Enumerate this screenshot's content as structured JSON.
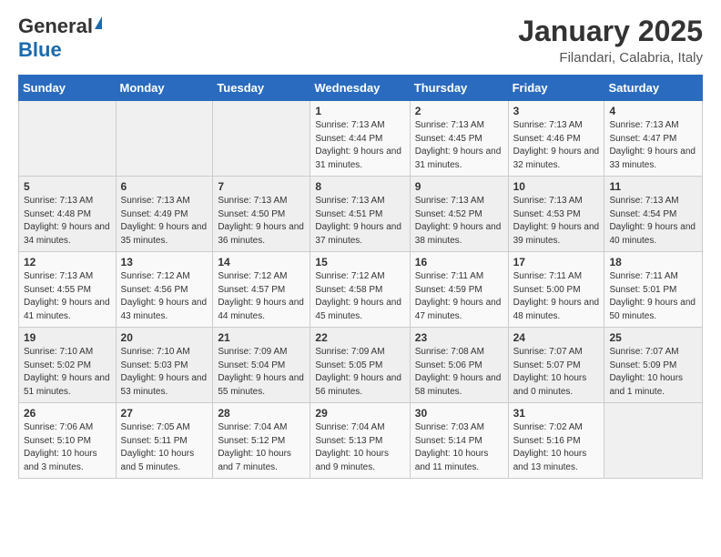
{
  "logo": {
    "general": "General",
    "blue": "Blue"
  },
  "header": {
    "month": "January 2025",
    "location": "Filandari, Calabria, Italy"
  },
  "weekdays": [
    "Sunday",
    "Monday",
    "Tuesday",
    "Wednesday",
    "Thursday",
    "Friday",
    "Saturday"
  ],
  "weeks": [
    [
      {
        "day": "",
        "info": ""
      },
      {
        "day": "",
        "info": ""
      },
      {
        "day": "",
        "info": ""
      },
      {
        "day": "1",
        "info": "Sunrise: 7:13 AM\nSunset: 4:44 PM\nDaylight: 9 hours and 31 minutes."
      },
      {
        "day": "2",
        "info": "Sunrise: 7:13 AM\nSunset: 4:45 PM\nDaylight: 9 hours and 31 minutes."
      },
      {
        "day": "3",
        "info": "Sunrise: 7:13 AM\nSunset: 4:46 PM\nDaylight: 9 hours and 32 minutes."
      },
      {
        "day": "4",
        "info": "Sunrise: 7:13 AM\nSunset: 4:47 PM\nDaylight: 9 hours and 33 minutes."
      }
    ],
    [
      {
        "day": "5",
        "info": "Sunrise: 7:13 AM\nSunset: 4:48 PM\nDaylight: 9 hours and 34 minutes."
      },
      {
        "day": "6",
        "info": "Sunrise: 7:13 AM\nSunset: 4:49 PM\nDaylight: 9 hours and 35 minutes."
      },
      {
        "day": "7",
        "info": "Sunrise: 7:13 AM\nSunset: 4:50 PM\nDaylight: 9 hours and 36 minutes."
      },
      {
        "day": "8",
        "info": "Sunrise: 7:13 AM\nSunset: 4:51 PM\nDaylight: 9 hours and 37 minutes."
      },
      {
        "day": "9",
        "info": "Sunrise: 7:13 AM\nSunset: 4:52 PM\nDaylight: 9 hours and 38 minutes."
      },
      {
        "day": "10",
        "info": "Sunrise: 7:13 AM\nSunset: 4:53 PM\nDaylight: 9 hours and 39 minutes."
      },
      {
        "day": "11",
        "info": "Sunrise: 7:13 AM\nSunset: 4:54 PM\nDaylight: 9 hours and 40 minutes."
      }
    ],
    [
      {
        "day": "12",
        "info": "Sunrise: 7:13 AM\nSunset: 4:55 PM\nDaylight: 9 hours and 41 minutes."
      },
      {
        "day": "13",
        "info": "Sunrise: 7:12 AM\nSunset: 4:56 PM\nDaylight: 9 hours and 43 minutes."
      },
      {
        "day": "14",
        "info": "Sunrise: 7:12 AM\nSunset: 4:57 PM\nDaylight: 9 hours and 44 minutes."
      },
      {
        "day": "15",
        "info": "Sunrise: 7:12 AM\nSunset: 4:58 PM\nDaylight: 9 hours and 45 minutes."
      },
      {
        "day": "16",
        "info": "Sunrise: 7:11 AM\nSunset: 4:59 PM\nDaylight: 9 hours and 47 minutes."
      },
      {
        "day": "17",
        "info": "Sunrise: 7:11 AM\nSunset: 5:00 PM\nDaylight: 9 hours and 48 minutes."
      },
      {
        "day": "18",
        "info": "Sunrise: 7:11 AM\nSunset: 5:01 PM\nDaylight: 9 hours and 50 minutes."
      }
    ],
    [
      {
        "day": "19",
        "info": "Sunrise: 7:10 AM\nSunset: 5:02 PM\nDaylight: 9 hours and 51 minutes."
      },
      {
        "day": "20",
        "info": "Sunrise: 7:10 AM\nSunset: 5:03 PM\nDaylight: 9 hours and 53 minutes."
      },
      {
        "day": "21",
        "info": "Sunrise: 7:09 AM\nSunset: 5:04 PM\nDaylight: 9 hours and 55 minutes."
      },
      {
        "day": "22",
        "info": "Sunrise: 7:09 AM\nSunset: 5:05 PM\nDaylight: 9 hours and 56 minutes."
      },
      {
        "day": "23",
        "info": "Sunrise: 7:08 AM\nSunset: 5:06 PM\nDaylight: 9 hours and 58 minutes."
      },
      {
        "day": "24",
        "info": "Sunrise: 7:07 AM\nSunset: 5:07 PM\nDaylight: 10 hours and 0 minutes."
      },
      {
        "day": "25",
        "info": "Sunrise: 7:07 AM\nSunset: 5:09 PM\nDaylight: 10 hours and 1 minute."
      }
    ],
    [
      {
        "day": "26",
        "info": "Sunrise: 7:06 AM\nSunset: 5:10 PM\nDaylight: 10 hours and 3 minutes."
      },
      {
        "day": "27",
        "info": "Sunrise: 7:05 AM\nSunset: 5:11 PM\nDaylight: 10 hours and 5 minutes."
      },
      {
        "day": "28",
        "info": "Sunrise: 7:04 AM\nSunset: 5:12 PM\nDaylight: 10 hours and 7 minutes."
      },
      {
        "day": "29",
        "info": "Sunrise: 7:04 AM\nSunset: 5:13 PM\nDaylight: 10 hours and 9 minutes."
      },
      {
        "day": "30",
        "info": "Sunrise: 7:03 AM\nSunset: 5:14 PM\nDaylight: 10 hours and 11 minutes."
      },
      {
        "day": "31",
        "info": "Sunrise: 7:02 AM\nSunset: 5:16 PM\nDaylight: 10 hours and 13 minutes."
      },
      {
        "day": "",
        "info": ""
      }
    ]
  ]
}
